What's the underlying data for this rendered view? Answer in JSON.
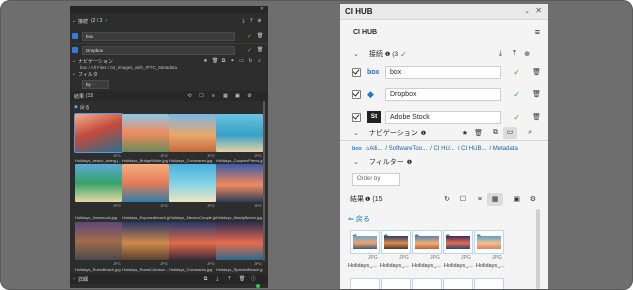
{
  "left_panel": {
    "connections_label": "接続",
    "connections_count_text": "(2 / 3",
    "services": [
      {
        "name": "box"
      },
      {
        "name": "Dropbox"
      }
    ],
    "navigation_label": "ナビゲーション",
    "breadcrumb": "box / All Files / 04_Images_with_IPTC_Metadata",
    "filter_label": "フィルタ",
    "filter_value": "by",
    "results_label": "結果",
    "results_count": "(15",
    "back_label": "戻る",
    "thumbnails": [
      {
        "caption": "Holidays_beach_swing.j...",
        "badge": "JPG"
      },
      {
        "caption": "Holidays_BridgeWhite.jpg",
        "badge": "JPG"
      },
      {
        "caption": "Holidays_Colomares.jpg",
        "badge": "JPG"
      },
      {
        "caption": "Holidays_CouplesPiercs.jpg",
        "badge": "JPG"
      },
      {
        "caption": "Holidays_Hammock.jpg",
        "badge": "JPG"
      },
      {
        "caption": "Holidays_Exposedbeach.jpg",
        "badge": "JPG"
      },
      {
        "caption": "Holidays_MexicoCouple.jpg",
        "badge": "JPG"
      },
      {
        "caption": "Holidays_NewlyBeach.jpg",
        "badge": "JPG"
      },
      {
        "caption": "Holidays_RuinsBeach.jpg",
        "badge": "JPG"
      },
      {
        "caption": "Holidays_RomeColosse...",
        "badge": "JPG"
      },
      {
        "caption": "Holidays_Colomares.jpg",
        "badge": "JPG"
      },
      {
        "caption": "Holidays_SpanishBeach.jpg",
        "badge": "JPG"
      }
    ],
    "footer_label": "詳細"
  },
  "right_panel": {
    "window_title": "CI HUB",
    "app_label": "CI HUB",
    "connections_label": "接続",
    "connections_count_text": "(3",
    "services": [
      {
        "logo": "box",
        "name": "box"
      },
      {
        "logo": "◆",
        "name": "Dropbox"
      },
      {
        "logo": "St",
        "name": "Adobe Stock"
      }
    ],
    "navigation_label": "ナビゲーション",
    "breadcrumb": {
      "root": "box",
      "parts": [
        "Alli...",
        "/ SoftwareToo...",
        "/ CI HU...",
        "/ CI HUB...",
        "/ Metadata"
      ]
    },
    "filter_label": "フィルター",
    "order_by_placeholder": "Order by",
    "results_label": "結果",
    "results_count": "(15",
    "back_label": "戻る",
    "thumbnails": [
      {
        "caption": "Holidays_...",
        "badge": "JPG"
      },
      {
        "caption": "Holidays_...",
        "badge": "JPG"
      },
      {
        "caption": "Holidays_...",
        "badge": "JPG"
      },
      {
        "caption": "Holidays_...",
        "badge": "JPG"
      },
      {
        "caption": "Holidays_...",
        "badge": "JPG"
      }
    ]
  },
  "colors": {
    "dark_bg": "#2d2d2d",
    "light_bg": "#f4f4f4",
    "accent_green": "#2ea44f",
    "accent_blue": "#2f7fd4"
  }
}
